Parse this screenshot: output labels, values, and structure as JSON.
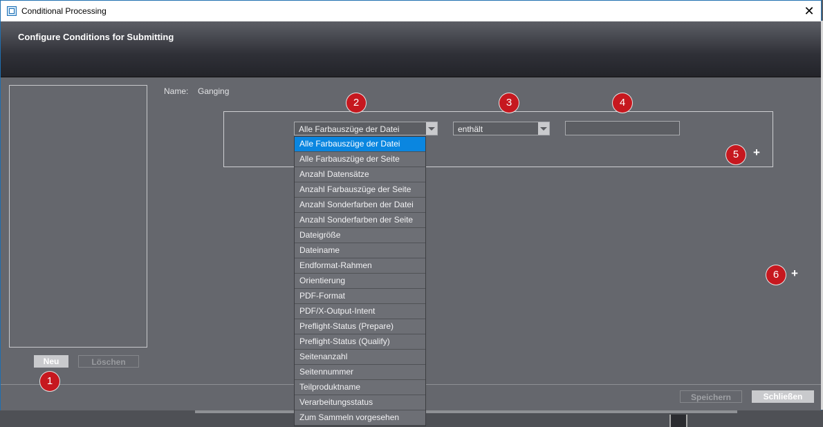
{
  "window": {
    "title": "Conditional Processing",
    "close_glyph": "✕"
  },
  "header": {
    "title": "Configure Conditions for Submitting"
  },
  "left_panel": {
    "new_button": "Neu",
    "delete_button": "Löschen"
  },
  "name": {
    "label": "Name:",
    "value": "Ganging"
  },
  "condition": {
    "field_value": "Alle Farbauszüge der Datei",
    "operator_value": "enthält",
    "value_text": "",
    "add_condition_glyph": "+"
  },
  "add_group_glyph": "+",
  "dropdown": {
    "selected_index": 0,
    "items": [
      "Alle Farbauszüge der Datei",
      "Alle Farbauszüge der Seite",
      "Anzahl Datensätze",
      "Anzahl Farbauszüge der Seite",
      "Anzahl Sonderfarben der Datei",
      "Anzahl Sonderfarben der Seite",
      "Dateigröße",
      "Dateiname",
      "Endformat-Rahmen",
      "Orientierung",
      "PDF-Format",
      "PDF/X-Output-Intent",
      "Preflight-Status (Prepare)",
      "Preflight-Status (Qualify)",
      "Seitenanzahl",
      "Seitennummer",
      "Teilproduktname",
      "Verarbeitungsstatus",
      "Zum Sammeln vorgesehen"
    ]
  },
  "footer": {
    "save_button": "Speichern",
    "close_button": "Schließen"
  },
  "badges": {
    "b1": "1",
    "b2": "2",
    "b3": "3",
    "b4": "4",
    "b5": "5",
    "b6": "6"
  },
  "colors": {
    "badge": "#c6181f",
    "selection": "#0a86e0",
    "panel": "#65676d"
  },
  "icons": {
    "app": "app-icon",
    "dropdown_arrow": "chevron-down-icon",
    "add": "plus-icon",
    "close": "close-icon"
  }
}
